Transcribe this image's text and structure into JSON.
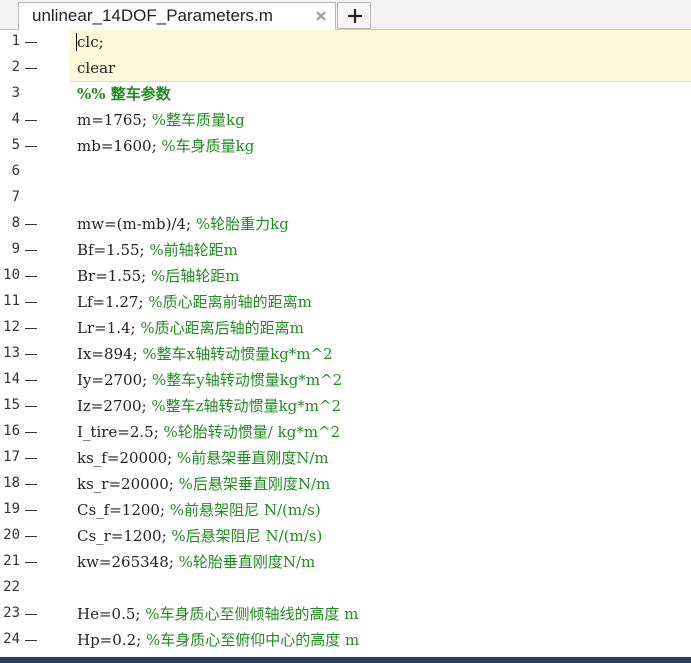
{
  "tab": {
    "title": "unlinear_14DOF_Parameters.m"
  },
  "lines": [
    {
      "n": "1",
      "mark": true,
      "code": "clc;",
      "comment": ""
    },
    {
      "n": "2",
      "mark": true,
      "code": "clear",
      "comment": ""
    },
    {
      "n": "3",
      "mark": false,
      "code": "",
      "comment": "",
      "section": "%% 整车参数"
    },
    {
      "n": "4",
      "mark": true,
      "code": "m=1765; ",
      "comment": "%整车质量kg"
    },
    {
      "n": "5",
      "mark": true,
      "code": "mb=1600; ",
      "comment": "%车身质量kg"
    },
    {
      "n": "6",
      "mark": false,
      "code": "",
      "comment": ""
    },
    {
      "n": "7",
      "mark": false,
      "code": "",
      "comment": ""
    },
    {
      "n": "8",
      "mark": true,
      "code": "mw=(m-mb)/4; ",
      "comment": "%轮胎重力kg"
    },
    {
      "n": "9",
      "mark": true,
      "code": "Bf=1.55; ",
      "comment": "%前轴轮距m"
    },
    {
      "n": "10",
      "mark": true,
      "code": "Br=1.55; ",
      "comment": "%后轴轮距m"
    },
    {
      "n": "11",
      "mark": true,
      "code": "Lf=1.27; ",
      "comment": "%质心距离前轴的距离m"
    },
    {
      "n": "12",
      "mark": true,
      "code": "Lr=1.4; ",
      "comment": "%质心距离后轴的距离m"
    },
    {
      "n": "13",
      "mark": true,
      "code": "Ix=894; ",
      "comment": "%整车x轴转动惯量kg*m^2"
    },
    {
      "n": "14",
      "mark": true,
      "code": "Iy=2700; ",
      "comment": "%整车y轴转动惯量kg*m^2"
    },
    {
      "n": "15",
      "mark": true,
      "code": "Iz=2700; ",
      "comment": "%整车z轴转动惯量kg*m^2"
    },
    {
      "n": "16",
      "mark": true,
      "code": "I_tire=2.5; ",
      "comment": "%轮胎转动惯量/ kg*m^2"
    },
    {
      "n": "17",
      "mark": true,
      "code": "ks_f=20000; ",
      "comment": "%前悬架垂直刚度N/m"
    },
    {
      "n": "18",
      "mark": true,
      "code": "ks_r=20000; ",
      "comment": "%后悬架垂直刚度N/m"
    },
    {
      "n": "19",
      "mark": true,
      "code": "Cs_f=1200; ",
      "comment": "%前悬架阻尼 N/(m/s)"
    },
    {
      "n": "20",
      "mark": true,
      "code": "Cs_r=1200; ",
      "comment": "%后悬架阻尼 N/(m/s)"
    },
    {
      "n": "21",
      "mark": true,
      "code": "kw=265348; ",
      "comment": "%轮胎垂直刚度N/m"
    },
    {
      "n": "22",
      "mark": false,
      "code": "",
      "comment": ""
    },
    {
      "n": "23",
      "mark": true,
      "code": "He=0.5; ",
      "comment": "%车身质心至侧倾轴线的高度 m"
    },
    {
      "n": "24",
      "mark": true,
      "code": "Hp=0.2; ",
      "comment": "%车身质心至俯仰中心的高度 m"
    }
  ],
  "colors": {
    "comment": "#228b22",
    "highlight": "#fdf8db"
  },
  "icons": {
    "close": "close-icon",
    "add": "plus-icon"
  }
}
